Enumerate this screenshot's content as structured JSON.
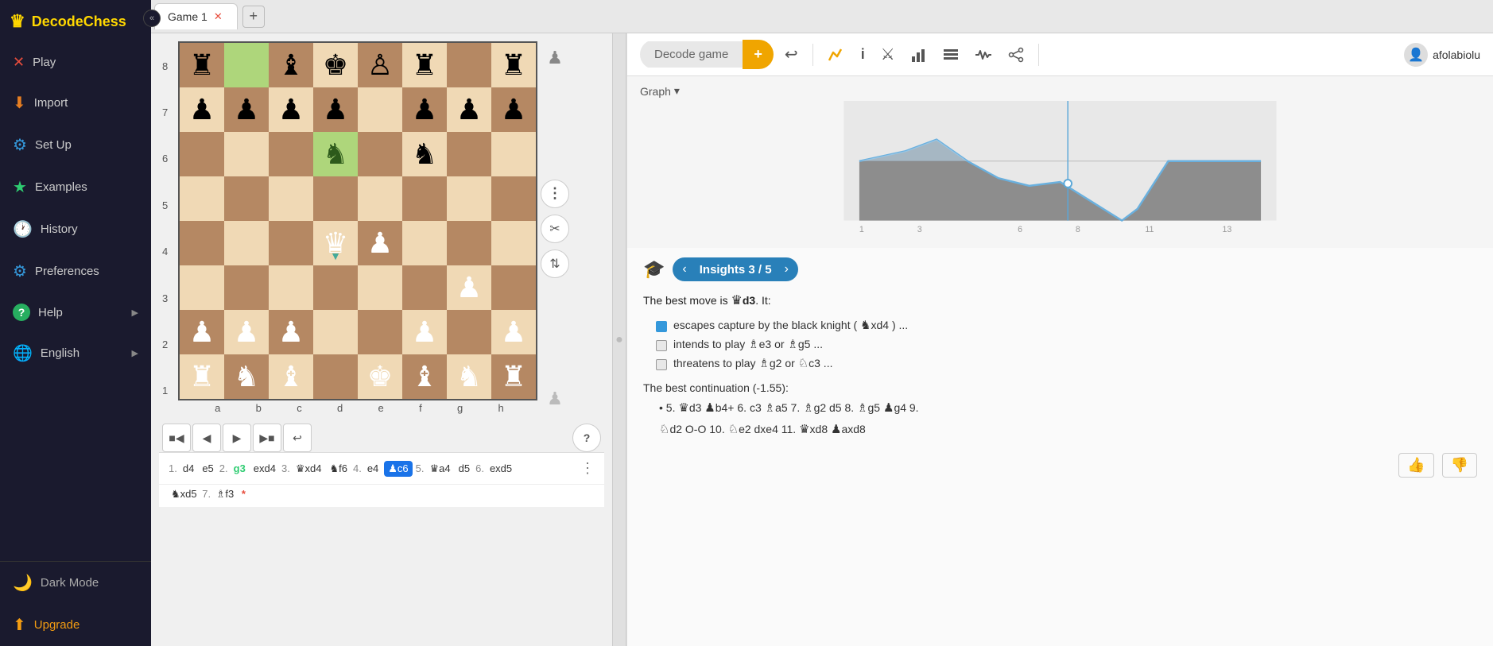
{
  "sidebar": {
    "logo_text": "DecodeChess",
    "logo_icon": "♛",
    "collapse_icon": "«",
    "items": [
      {
        "id": "play",
        "label": "Play",
        "icon": "✕",
        "color": "#e74c3c",
        "arrow": false
      },
      {
        "id": "import",
        "label": "Import",
        "icon": "⬇",
        "color": "#e67e22",
        "arrow": false
      },
      {
        "id": "setup",
        "label": "Set Up",
        "icon": "⚙",
        "color": "#3498db",
        "arrow": false
      },
      {
        "id": "examples",
        "label": "Examples",
        "icon": "★",
        "color": "#2ecc71",
        "arrow": false
      },
      {
        "id": "history",
        "label": "History",
        "icon": "🕐",
        "color": "#e67e22",
        "arrow": false
      },
      {
        "id": "preferences",
        "label": "Preferences",
        "icon": "⚙",
        "color": "#3498db",
        "arrow": false
      },
      {
        "id": "help",
        "label": "Help",
        "icon": "?",
        "color": "#27ae60",
        "arrow": true
      },
      {
        "id": "english",
        "label": "English",
        "icon": "🌐",
        "color": "#3498db",
        "arrow": true
      }
    ],
    "bottom_items": [
      {
        "id": "darkmode",
        "label": "Dark Mode",
        "icon": "🌙"
      },
      {
        "id": "upgrade",
        "label": "Upgrade",
        "icon": "⬆"
      }
    ]
  },
  "tabs": [
    {
      "id": "game1",
      "label": "Game 1",
      "active": true
    }
  ],
  "tab_add_label": "+",
  "toolbar": {
    "decode_label": "Decode game",
    "decode_plus": "+",
    "undo_icon": "↩",
    "user_name": "afolabiolu"
  },
  "graph": {
    "title": "Graph",
    "dropdown_icon": "▾",
    "x_labels": [
      "1",
      "3",
      "6",
      "8",
      "11",
      "13"
    ]
  },
  "insights": {
    "label": "Insights",
    "current": 3,
    "total": 5,
    "prev_icon": "‹",
    "next_icon": "›",
    "best_move_text": "The best move is",
    "best_move_notation": "♛d3",
    "best_move_suffix": ". It:",
    "bullets": [
      {
        "text": "escapes capture by the black knight ( ♞xd4 ) ..."
      },
      {
        "text": "intends to play ♗e3  or  ♗g5 ..."
      },
      {
        "text": "threatens to play ♗g2  or  ♘c3 ..."
      }
    ],
    "continuation_label": "The best continuation (-1.55):",
    "continuation_moves": "5. ♛d3  ♟b4+  6.  c3  ♗a5  7. ♗g2  d5  8. ♗g5  ♟g4  9. ♘d2  O-O  10. ♘e2  dxe4  11. ♛xd8  ♟axd8",
    "thumbs_up": "👍",
    "thumbs_down": "👎"
  },
  "moves": [
    {
      "num": "1.",
      "white": "d4",
      "black": "e5"
    },
    {
      "num": "2.",
      "white": "g3",
      "black": "exd4"
    },
    {
      "num": "3.",
      "white": "♛xd4",
      "black": "♞f6"
    },
    {
      "num": "4.",
      "white": "e4",
      "black": "c6",
      "active": true
    },
    {
      "num": "5.",
      "white": "♛a4",
      "black": "d5"
    },
    {
      "num": "6.",
      "white": "exd5"
    }
  ],
  "moves2": [
    {
      "num": "6.",
      "black": "♞xd5"
    },
    {
      "num": "7.",
      "white": "♗f3",
      "annotation": "*"
    }
  ],
  "board": {
    "coords_left": [
      "8",
      "7",
      "6",
      "5",
      "4",
      "3",
      "2",
      "1"
    ],
    "coords_bottom": [
      "a",
      "b",
      "c",
      "d",
      "e",
      "f",
      "g",
      "h"
    ]
  },
  "controls": {
    "first": "⏮",
    "prev": "◀",
    "next": "▶",
    "last": "⏭",
    "undo": "↩",
    "help": "?",
    "settings": "⋮",
    "scissors": "✂",
    "flip": "⇅"
  }
}
